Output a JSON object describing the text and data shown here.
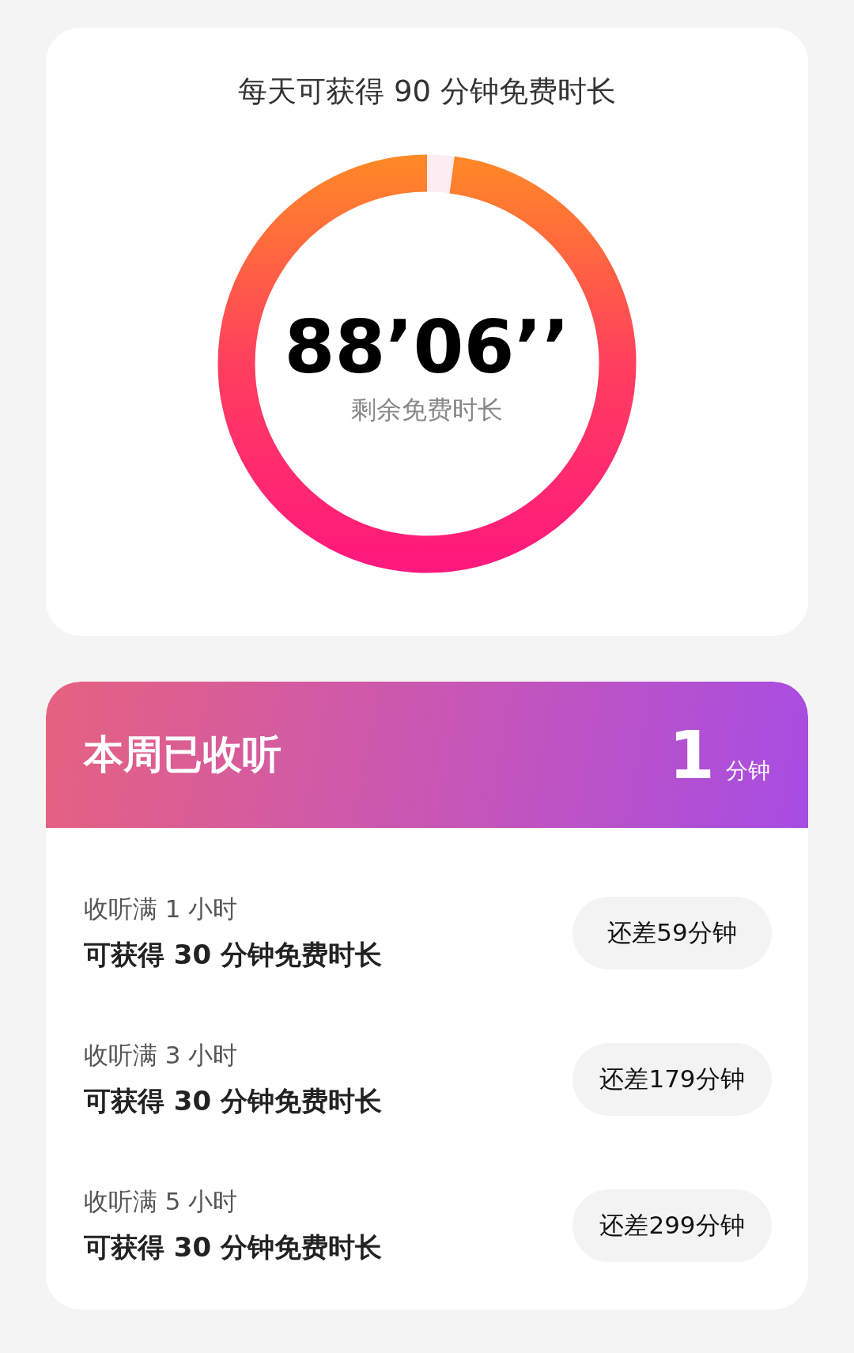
{
  "daily_card": {
    "title": "每天可获得 90 分钟免费时长",
    "remaining": {
      "time": "88’06’’",
      "label": "剩余免费时长",
      "level": 0.979
    }
  },
  "weekly_card": {
    "title": "本周已收听",
    "total": {
      "value": "1",
      "unit": "分钟"
    },
    "rewards": [
      {
        "condition": "收听满 1 小时",
        "reward": "可获得 30 分钟免费时长",
        "status": "还差59分钟"
      },
      {
        "condition": "收听满 3 小时",
        "reward": "可获得 30 分钟免费时长",
        "status": "还差179分钟"
      },
      {
        "condition": "收听满 5 小时",
        "reward": "可获得 30 分钟免费时长",
        "status": "还差299分钟"
      }
    ]
  }
}
